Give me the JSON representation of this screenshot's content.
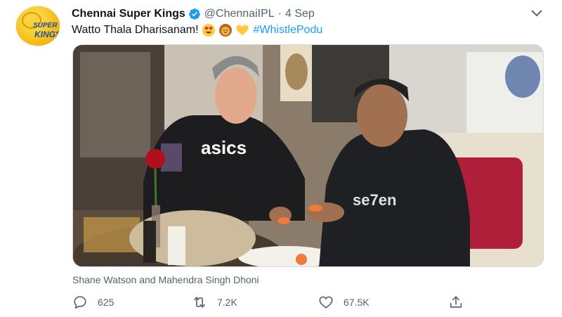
{
  "tweet": {
    "display_name": "Chennai Super Kings",
    "handle": "@ChennaiIPL",
    "separator": "·",
    "date": "4 Sep",
    "text": "Watto Thala Dharisanam!",
    "emojis": [
      "heart-eyes-emoji",
      "lion-emoji",
      "yellow-heart-emoji"
    ],
    "hashtag": "#WhistlePodu",
    "media_caption": "Shane Watson and Mahendra Singh Dhoni",
    "avatar_text": [
      "SUPER",
      "KINGS"
    ]
  },
  "actions": {
    "replies": "625",
    "retweets": "7.2K",
    "likes": "67.5K"
  },
  "colors": {
    "accent": "#1d9bf0",
    "secondary_text": "#536471",
    "avatar_yellow": "#f6c21a"
  }
}
